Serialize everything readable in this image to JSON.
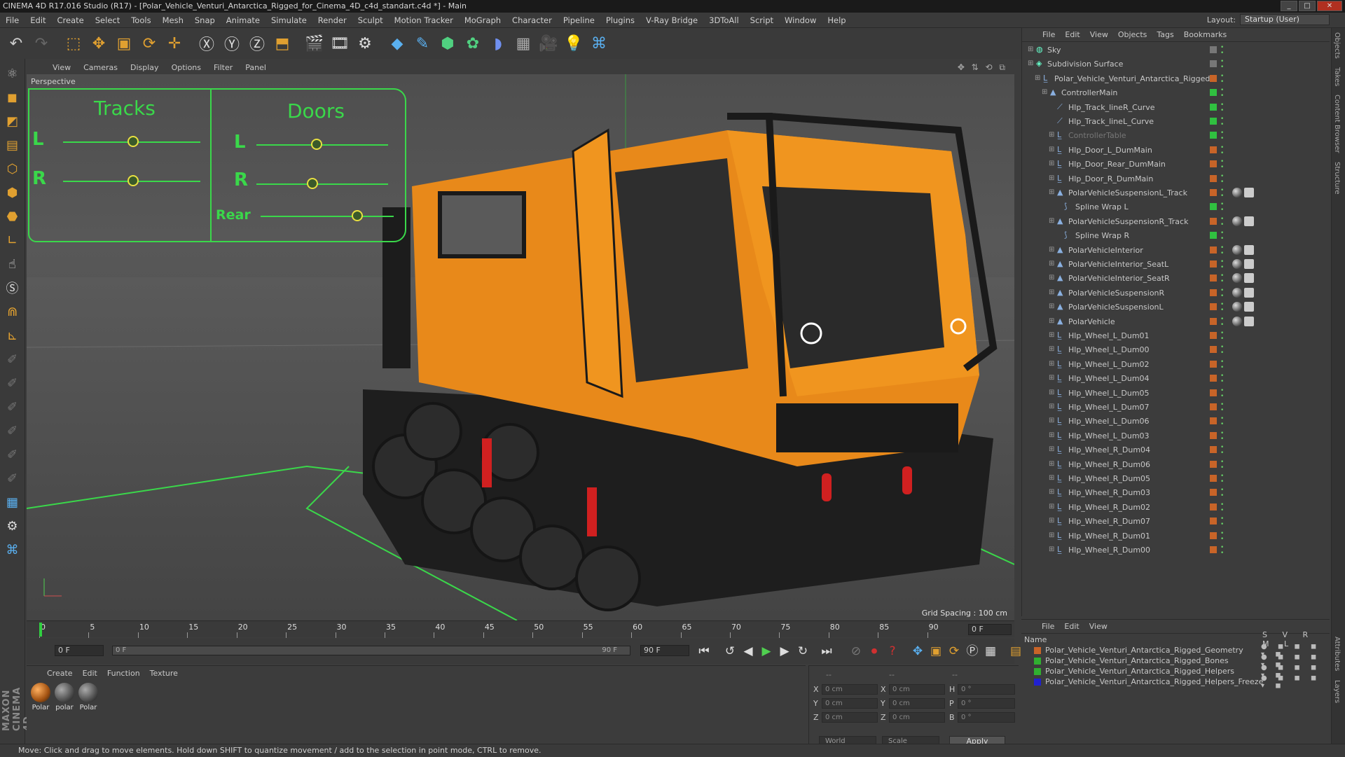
{
  "title": "CINEMA 4D R17.016 Studio (R17) - [Polar_Vehicle_Venturi_Antarctica_Rigged_for_Cinema_4D_c4d_standart.c4d *] - Main",
  "menu": [
    "File",
    "Edit",
    "Create",
    "Select",
    "Tools",
    "Mesh",
    "Snap",
    "Animate",
    "Simulate",
    "Render",
    "Sculpt",
    "Motion Tracker",
    "MoGraph",
    "Character",
    "Pipeline",
    "Plugins",
    "V-Ray Bridge",
    "3DToAll",
    "Script",
    "Window",
    "Help"
  ],
  "layout": {
    "label": "Layout:",
    "value": "Startup (User)"
  },
  "viewport": {
    "menu": [
      "View",
      "Cameras",
      "Display",
      "Options",
      "Filter",
      "Panel"
    ],
    "label": "Perspective",
    "grid_spacing": "Grid Spacing : 100 cm",
    "hud": {
      "tracks": "Tracks",
      "doors": "Doors",
      "l": "L",
      "r": "R",
      "rear": "Rear"
    }
  },
  "object_manager": {
    "menu": [
      "File",
      "Edit",
      "View",
      "Objects",
      "Tags",
      "Bookmarks"
    ],
    "items": [
      {
        "name": "Sky",
        "level": 0
      },
      {
        "name": "Subdivision Surface",
        "level": 0
      },
      {
        "name": "Polar_Vehicle_Venturi_Antarctica_Rigged",
        "level": 1
      },
      {
        "name": "ControllerMain",
        "level": 2
      },
      {
        "name": "Hlp_Track_lineR_Curve",
        "level": 3
      },
      {
        "name": "Hlp_Track_lineL_Curve",
        "level": 3
      },
      {
        "name": "ControllerTable",
        "level": 3
      },
      {
        "name": "Hlp_Door_L_DumMain",
        "level": 3
      },
      {
        "name": "Hlp_Door_Rear_DumMain",
        "level": 3
      },
      {
        "name": "Hlp_Door_R_DumMain",
        "level": 3
      },
      {
        "name": "PolarVehicleSuspensionL_Track",
        "level": 3
      },
      {
        "name": "Spline Wrap L",
        "level": 4
      },
      {
        "name": "PolarVehicleSuspensionR_Track",
        "level": 3
      },
      {
        "name": "Spline Wrap R",
        "level": 4
      },
      {
        "name": "PolarVehicleInterior",
        "level": 3
      },
      {
        "name": "PolarVehicleInterior_SeatL",
        "level": 3
      },
      {
        "name": "PolarVehicleInterior_SeatR",
        "level": 3
      },
      {
        "name": "PolarVehicleSuspensionR",
        "level": 3
      },
      {
        "name": "PolarVehicleSuspensionL",
        "level": 3
      },
      {
        "name": "PolarVehicle",
        "level": 3
      },
      {
        "name": "Hlp_Wheel_L_Dum01",
        "level": 3
      },
      {
        "name": "Hlp_Wheel_L_Dum00",
        "level": 3
      },
      {
        "name": "Hlp_Wheel_L_Dum02",
        "level": 3
      },
      {
        "name": "Hlp_Wheel_L_Dum04",
        "level": 3
      },
      {
        "name": "Hlp_Wheel_L_Dum05",
        "level": 3
      },
      {
        "name": "Hlp_Wheel_L_Dum07",
        "level": 3
      },
      {
        "name": "Hlp_Wheel_L_Dum06",
        "level": 3
      },
      {
        "name": "Hlp_Wheel_L_Dum03",
        "level": 3
      },
      {
        "name": "Hlp_Wheel_R_Dum04",
        "level": 3
      },
      {
        "name": "Hlp_Wheel_R_Dum06",
        "level": 3
      },
      {
        "name": "Hlp_Wheel_R_Dum05",
        "level": 3
      },
      {
        "name": "Hlp_Wheel_R_Dum03",
        "level": 3
      },
      {
        "name": "Hlp_Wheel_R_Dum02",
        "level": 3
      },
      {
        "name": "Hlp_Wheel_R_Dum07",
        "level": 3
      },
      {
        "name": "Hlp_Wheel_R_Dum01",
        "level": 3
      },
      {
        "name": "Hlp_Wheel_R_Dum00",
        "level": 3
      }
    ]
  },
  "layer_manager": {
    "menu": [
      "File",
      "Edit",
      "View"
    ],
    "header": "Name",
    "columns": "S V R M L",
    "layers": [
      {
        "name": "Polar_Vehicle_Venturi_Antarctica_Rigged_Geometry",
        "color": "#c86428"
      },
      {
        "name": "Polar_Vehicle_Venturi_Antarctica_Rigged_Bones",
        "color": "#30b030"
      },
      {
        "name": "Polar_Vehicle_Venturi_Antarctica_Rigged_Helpers",
        "color": "#30b030"
      },
      {
        "name": "Polar_Vehicle_Venturi_Antarctica_Rigged_Helpers_Freeze",
        "color": "#2020d0"
      }
    ]
  },
  "timeline": {
    "ticks": [
      "0",
      "5",
      "10",
      "15",
      "20",
      "25",
      "30",
      "35",
      "40",
      "45",
      "50",
      "55",
      "60",
      "65",
      "70",
      "75",
      "80",
      "85",
      "90"
    ],
    "current": "0 F",
    "start": "0 F",
    "slider_left": "0 F",
    "slider_right": "90 F",
    "end": "90 F"
  },
  "material_manager": {
    "menu": [
      "Create",
      "Edit",
      "Function",
      "Texture"
    ],
    "materials": [
      "Polar",
      "polar",
      "Polar"
    ]
  },
  "coordinates": {
    "x": "0 cm",
    "y": "0 cm",
    "z": "0 cm",
    "sx": "0 cm",
    "sy": "0 cm",
    "sz": "0 cm",
    "h": "0 °",
    "p": "0 °",
    "b": "0 °",
    "mode": "World",
    "scale": "Scale",
    "apply": "Apply",
    "lbl_x": "X",
    "lbl_y": "Y",
    "lbl_z": "Z",
    "lbl_h": "H",
    "lbl_p": "P",
    "lbl_b": "B",
    "dash1": "--",
    "dash2": "--",
    "dash3": "--"
  },
  "status": "Move: Click and drag to move elements. Hold down SHIFT to quantize movement / add to the selection in point mode, CTRL to remove.",
  "side_tabs": [
    "Objects",
    "Takes",
    "Content Browser",
    "Structure"
  ],
  "side_tabs2": [
    "Attributes",
    "Layers"
  ],
  "logo": "MAXON CINEMA 4D"
}
